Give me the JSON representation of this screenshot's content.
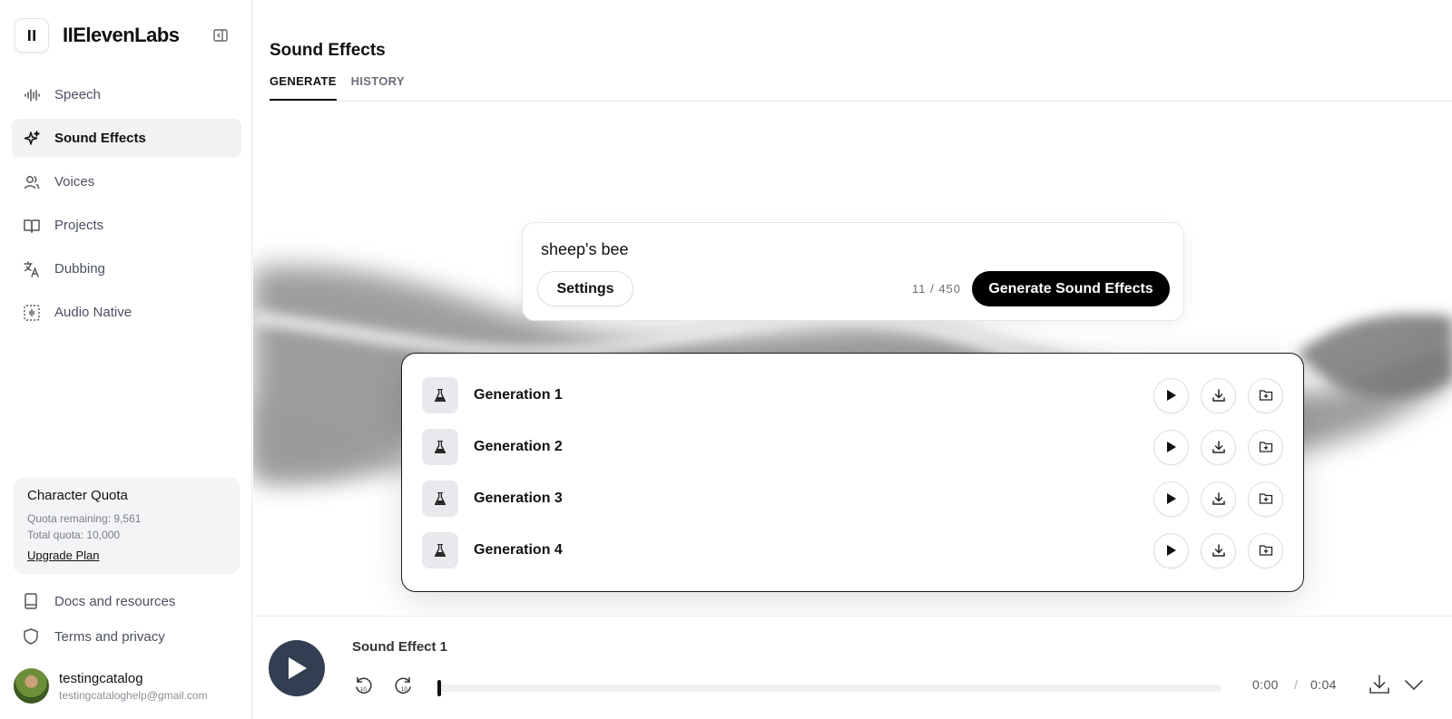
{
  "brand": {
    "name": "IIElevenLabs",
    "button_icon": "pause-icon"
  },
  "sidebar": {
    "items": [
      {
        "label": "Speech",
        "icon": "waveform-icon",
        "active": false
      },
      {
        "label": "Sound Effects",
        "icon": "sparkle-icon",
        "active": true
      },
      {
        "label": "Voices",
        "icon": "users-icon",
        "active": false
      },
      {
        "label": "Projects",
        "icon": "book-icon",
        "active": false
      },
      {
        "label": "Dubbing",
        "icon": "translate-icon",
        "active": false
      },
      {
        "label": "Audio Native",
        "icon": "audio-native-icon",
        "active": false
      }
    ],
    "quota": {
      "title": "Character Quota",
      "remaining": "Quota remaining: 9,561",
      "total": "Total quota: 10,000",
      "upgrade": "Upgrade Plan"
    },
    "footer": {
      "docs": "Docs and resources",
      "terms": "Terms and privacy"
    },
    "user": {
      "name": "testingcatalog",
      "email": "testingcataloghelp@gmail.com"
    }
  },
  "main": {
    "title": "Sound Effects",
    "tabs": [
      {
        "label": "GENERATE",
        "active": true
      },
      {
        "label": "HISTORY",
        "active": false
      }
    ],
    "prompt": {
      "text": "sheep's bee",
      "settings_label": "Settings",
      "counter": "11 / 450",
      "generate_label": "Generate Sound Effects"
    },
    "generations": [
      {
        "name": "Generation 1"
      },
      {
        "name": "Generation 2"
      },
      {
        "name": "Generation 3"
      },
      {
        "name": "Generation 4"
      }
    ]
  },
  "player": {
    "title": "Sound Effect 1",
    "current_time": "0:00",
    "separator": "/",
    "duration": "0:04",
    "progress": 0
  },
  "colors": {
    "accent": "#000000",
    "player_button": "#323f52",
    "active_nav_bg": "#f1f2f4",
    "quota_bg": "#f3f4f6"
  }
}
